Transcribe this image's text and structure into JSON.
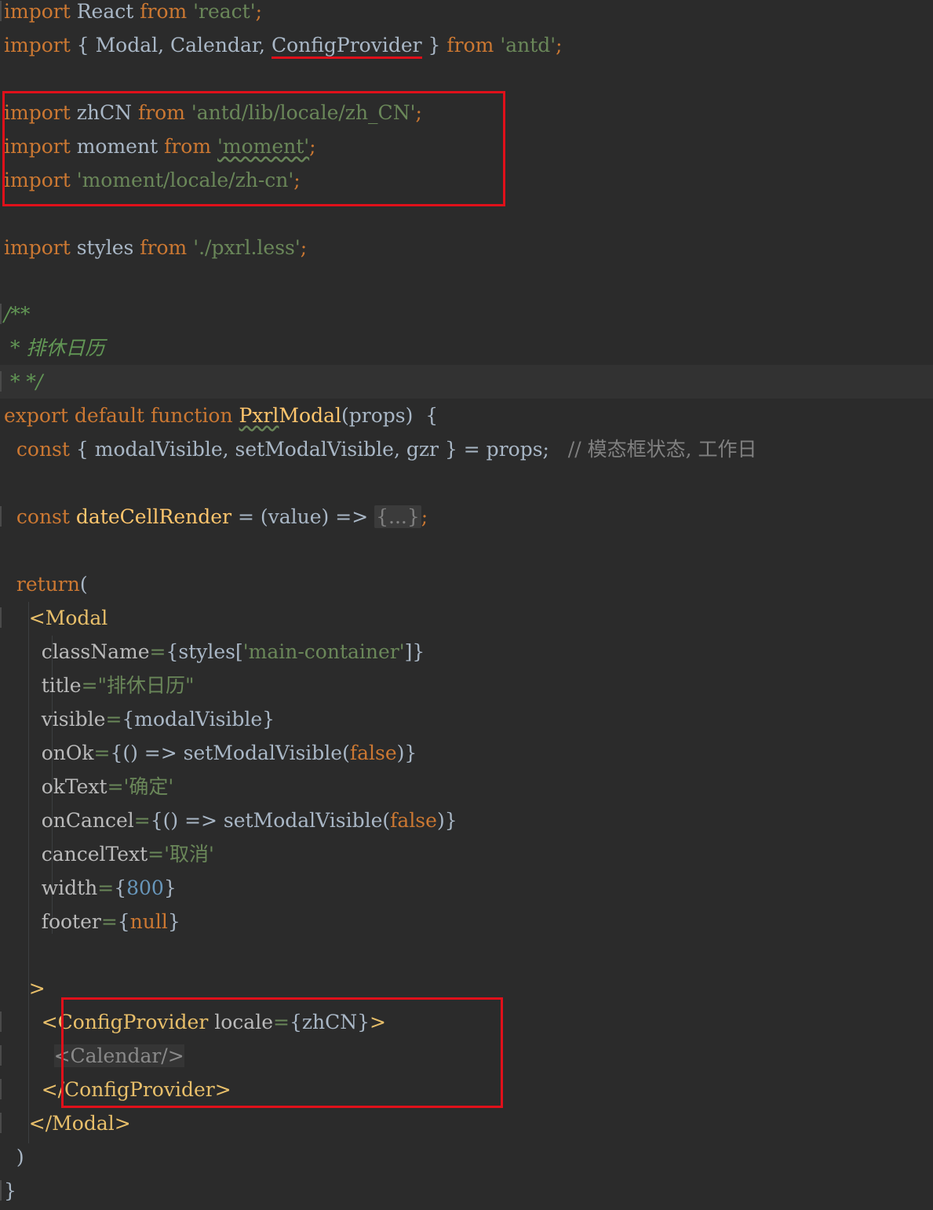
{
  "lines": {
    "l1": [
      "import",
      " React ",
      "from",
      " 'react'",
      ";"
    ],
    "l2": [
      "import",
      " { Modal, Calendar, ",
      "ConfigProvider",
      " } ",
      "from",
      " 'antd'",
      ";"
    ],
    "l4": [
      "import",
      " zhCN ",
      "from",
      " 'antd/lib/locale/zh_CN'",
      ";"
    ],
    "l5": [
      "import",
      " moment ",
      "from",
      " ",
      "'moment'",
      ";"
    ],
    "l6": [
      "import",
      " 'moment/locale/zh-cn'",
      ";"
    ],
    "l8": [
      "import",
      " styles ",
      "from",
      " './pxrl.less'",
      ";"
    ],
    "l10": [
      "/**"
    ],
    "l11": [
      " * 排休日历"
    ],
    "l12": [
      " * */"
    ],
    "l13": [
      "export default function",
      " ",
      "Pxrl",
      "Modal",
      "(props)  {"
    ],
    "l14": [
      "  ",
      "const",
      " { modalVisible, setModalVisible, gzr } = props;",
      "   // 模态框状态, 工作日"
    ],
    "l16": [
      "  ",
      "const",
      " ",
      "dateCellRender",
      " = (value) => ",
      "{...}",
      ";"
    ],
    "l18": [
      "  ",
      "return",
      "("
    ],
    "l19": [
      "    ",
      "<Modal"
    ],
    "l20": [
      "      ",
      "className",
      "=",
      "{styles[",
      "'main-container'",
      "]}"
    ],
    "l21": [
      "      ",
      "title",
      "=",
      "\"排休日历\""
    ],
    "l22": [
      "      ",
      "visible",
      "=",
      "{modalVisible}"
    ],
    "l23": [
      "      ",
      "onOk",
      "=",
      "{() => setModalVisible(",
      "false",
      ")}"
    ],
    "l24": [
      "      ",
      "okText",
      "=",
      "'确定'"
    ],
    "l25": [
      "      ",
      "onCancel",
      "=",
      "{() => setModalVisible(",
      "false",
      ")}"
    ],
    "l26": [
      "      ",
      "cancelText",
      "=",
      "'取消'"
    ],
    "l27": [
      "      ",
      "width",
      "=",
      "{",
      "800",
      "}"
    ],
    "l28": [
      "      ",
      "footer",
      "=",
      "{",
      "null",
      "}"
    ],
    "l30": [
      "    ",
      ">"
    ],
    "l31": [
      "      ",
      "<ConfigProvider",
      " ",
      "locale",
      "=",
      "{zhCN}",
      ">"
    ],
    "l32": [
      "        ",
      "<Calendar/>"
    ],
    "l33": [
      "      ",
      "</ConfigProvider>"
    ],
    "l34": [
      "    ",
      "</Modal>"
    ],
    "l35": [
      "  )"
    ],
    "l36": [
      "}"
    ]
  },
  "annotations": {
    "box1_label": "locale-imports-highlight",
    "box2_label": "config-provider-highlight",
    "accent_color": "#e0101a"
  }
}
